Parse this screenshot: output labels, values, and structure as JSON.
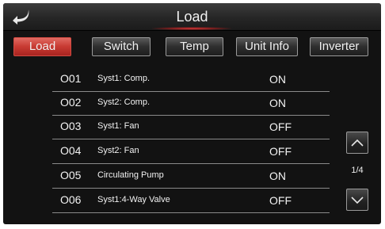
{
  "header": {
    "title": "Load",
    "back_icon": "back-arrow-icon"
  },
  "tabs": [
    {
      "label": "Load",
      "active": true
    },
    {
      "label": "Switch",
      "active": false
    },
    {
      "label": "Temp",
      "active": false
    },
    {
      "label": "Unit Info",
      "active": false
    },
    {
      "label": "Inverter",
      "active": false
    }
  ],
  "rows": [
    {
      "code": "O01",
      "name": "Syst1: Comp.",
      "state": "ON"
    },
    {
      "code": "O02",
      "name": "Syst2: Comp.",
      "state": "ON"
    },
    {
      "code": "O03",
      "name": "Syst1: Fan",
      "state": "OFF"
    },
    {
      "code": "O04",
      "name": "Syst2: Fan",
      "state": "OFF"
    },
    {
      "code": "O05",
      "name": "Circulating Pump",
      "state": "ON"
    },
    {
      "code": "O06",
      "name": "Syst1:4-Way Valve",
      "state": "OFF"
    }
  ],
  "pager": {
    "page": "1/4",
    "up_icon": "chevron-up-icon",
    "down_icon": "chevron-down-icon"
  },
  "colors": {
    "active_tab": "#c73a32",
    "background": "#121212",
    "text": "#f2f2f2"
  }
}
